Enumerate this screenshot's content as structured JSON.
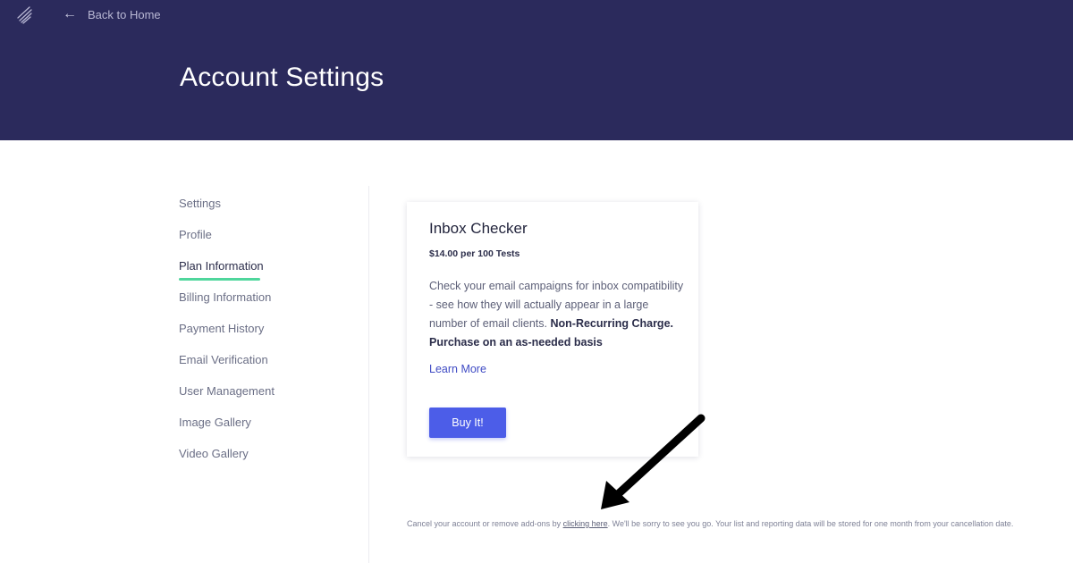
{
  "header": {
    "logo_icon": "stripes-logo-icon",
    "back_icon": "arrow-left-icon",
    "back_label": "Back to Home",
    "title": "Account Settings",
    "background_color": "#2b2a5c"
  },
  "sidebar": {
    "active_index": 2,
    "active_underline_color": "#4fd69c",
    "items": [
      {
        "label": "Settings"
      },
      {
        "label": "Profile"
      },
      {
        "label": "Plan Information"
      },
      {
        "label": "Billing Information"
      },
      {
        "label": "Payment History"
      },
      {
        "label": "Email Verification"
      },
      {
        "label": "User Management"
      },
      {
        "label": "Image Gallery"
      },
      {
        "label": "Video Gallery"
      }
    ]
  },
  "card": {
    "title": "Inbox Checker",
    "price": "$14.00 per 100 Tests",
    "description": "Check your email campaigns for inbox compatibility - see how they will actually appear in a large number of email clients.",
    "description_bold": "Non-Recurring Charge. Purchase on an as-needed basis",
    "learn_more": "Learn More",
    "buy_button": "Buy It!",
    "button_color": "#4c5de8"
  },
  "footer": {
    "text_before": "Cancel your account or remove add-ons by ",
    "link_text": "clicking here",
    "text_after": ". We'll be sorry to see you go. Your list and reporting data will be stored for one month from your cancellation date."
  },
  "annotation": {
    "icon": "arrow-pointer-annotation-icon",
    "points_to": "clicking here"
  }
}
